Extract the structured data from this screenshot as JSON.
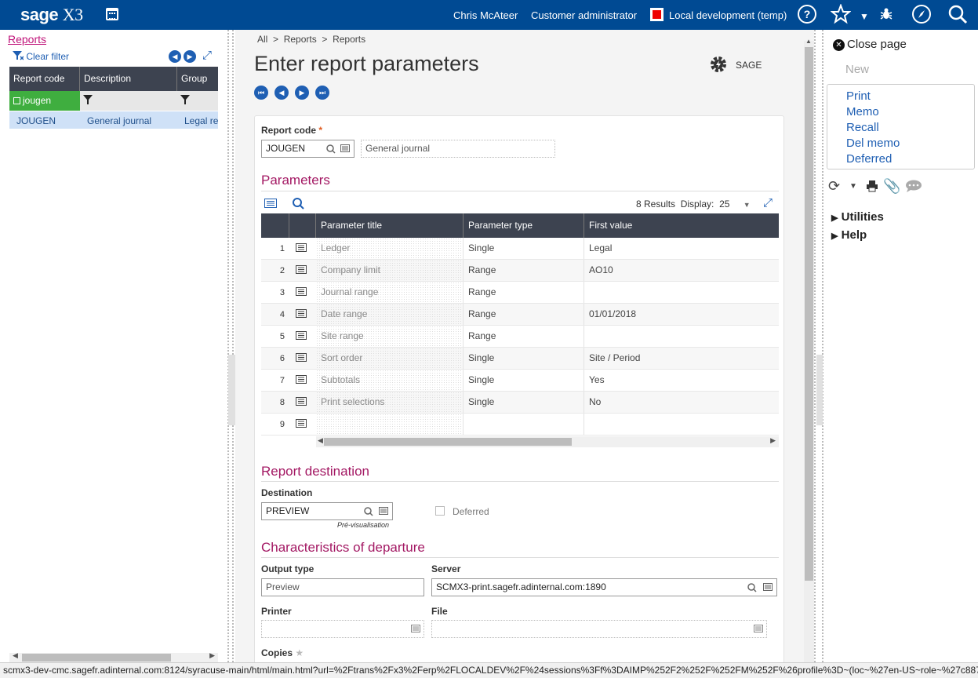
{
  "topbar": {
    "logo_main": "sage",
    "logo_suffix": "X3",
    "user": "Chris McAteer",
    "role": "Customer administrator",
    "environment": "Local development (temp)",
    "env_color": "#e00000",
    "bg_color": "#004a93"
  },
  "left": {
    "title": "Reports",
    "clear_filter": "Clear filter",
    "columns": [
      "Report code",
      "Description",
      "Group"
    ],
    "filter_value": "jougen",
    "row": {
      "code": "JOUGEN",
      "description": "General journal",
      "group": "Legal re"
    }
  },
  "breadcrumb": {
    "all": "All",
    "sep": ">",
    "level1": "Reports",
    "level2": "Reports"
  },
  "page": {
    "title": "Enter report parameters",
    "sage_button": "SAGE"
  },
  "form": {
    "report_code_label": "Report code",
    "required_mark": "*",
    "report_code_value": "JOUGEN",
    "report_code_desc": "General journal",
    "parameters_title": "Parameters",
    "results_text": "8 Results",
    "display_label": "Display:",
    "display_value": "25",
    "grid_columns": [
      "Parameter title",
      "Parameter type",
      "First value"
    ],
    "rows": [
      {
        "n": "1",
        "title": "Ledger",
        "type": "Single",
        "value": "Legal"
      },
      {
        "n": "2",
        "title": "Company limit",
        "type": "Range",
        "value": "AO10"
      },
      {
        "n": "3",
        "title": "Journal range",
        "type": "Range",
        "value": ""
      },
      {
        "n": "4",
        "title": "Date range",
        "type": "Range",
        "value": "01/01/2018"
      },
      {
        "n": "5",
        "title": "Site range",
        "type": "Range",
        "value": ""
      },
      {
        "n": "6",
        "title": "Sort order",
        "type": "Single",
        "value": "Site / Period"
      },
      {
        "n": "7",
        "title": "Subtotals",
        "type": "Single",
        "value": "Yes"
      },
      {
        "n": "8",
        "title": "Print selections",
        "type": "Single",
        "value": "No"
      },
      {
        "n": "9",
        "title": "",
        "type": "",
        "value": ""
      }
    ],
    "destination_section": "Report destination",
    "destination_label": "Destination",
    "destination_value": "PREVIEW",
    "destination_hint": "Pré-visualisation",
    "deferred_label": "Deferred",
    "departure_section": "Characteristics of departure",
    "output_type_label": "Output type",
    "output_type_value": "Preview",
    "server_label": "Server",
    "server_value": "SCMX3-print.sagefr.adinternal.com:1890",
    "printer_label": "Printer",
    "printer_value": "",
    "file_label": "File",
    "file_value": "",
    "copies_label": "Copies"
  },
  "right": {
    "close_page": "Close page",
    "new": "New",
    "actions": [
      "Print",
      "Memo",
      "Recall",
      "Del memo",
      "Deferred"
    ],
    "utilities": "Utilities",
    "help": "Help"
  },
  "status_url": "scmx3-dev-cmc.sagefr.adinternal.com:8124/syracuse-main/html/main.html?url=%2Ftrans%2Fx3%2Ferp%2FLOCALDEV%2F%24sessions%3Ff%3DAIMP%252F2%252F%252FM%252F%26profile%3D~(loc~%27en-US~role~%27c887..."
}
